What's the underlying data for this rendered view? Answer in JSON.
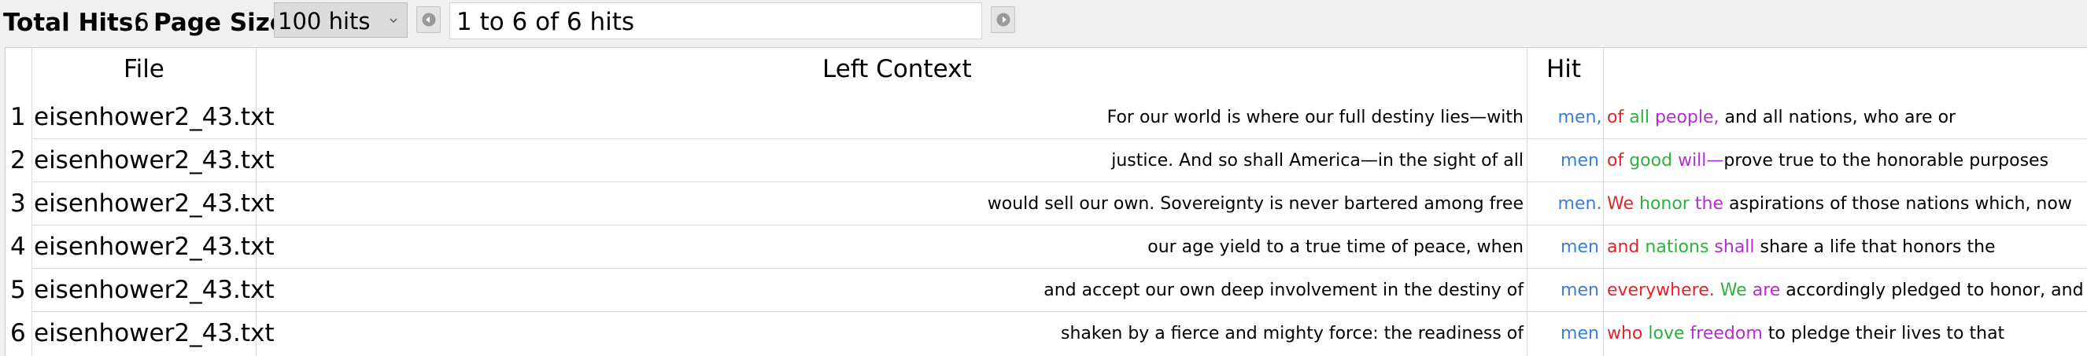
{
  "toolbar": {
    "total_hits_label": "Total Hits:",
    "total_hits_value": "6",
    "page_size_label": "Page Size",
    "page_size_value": "100 hits",
    "range_text": "1 to 6 of 6 hits",
    "prev_icon": "arrow-left-circle-icon",
    "next_icon": "arrow-right-circle-icon"
  },
  "columns": {
    "file": "File",
    "left_context": "Left Context",
    "hit": "Hit",
    "right_context": ""
  },
  "colors": {
    "hit": "#3b7ddd",
    "right_word_1": "#e3232a",
    "right_word_2": "#2db23e",
    "right_word_3": "#b32ed0"
  },
  "rows": [
    {
      "num": "1",
      "file": "eisenhower2_43.txt",
      "left": "For our world is where our full destiny lies—with",
      "hit": "men,",
      "r1": "of",
      "r2": "all",
      "r3": "people,",
      "rest": "and all nations, who are or"
    },
    {
      "num": "2",
      "file": "eisenhower2_43.txt",
      "left": "justice. And so shall America—in the sight of all",
      "hit": "men",
      "r1": "of",
      "r2": "good",
      "r3": "will—",
      "rest": "prove true to the honorable purposes"
    },
    {
      "num": "3",
      "file": "eisenhower2_43.txt",
      "left": "would sell our own. Sovereignty is never bartered among free",
      "hit": "men.",
      "r1": "We",
      "r2": "honor",
      "r3": "the",
      "rest": "aspirations of those nations which, now"
    },
    {
      "num": "4",
      "file": "eisenhower2_43.txt",
      "left": "our age yield to a true time of peace, when",
      "hit": "men",
      "r1": "and",
      "r2": "nations",
      "r3": "shall",
      "rest": "share a life that honors the"
    },
    {
      "num": "5",
      "file": "eisenhower2_43.txt",
      "left": "and accept our own deep involvement in the destiny of",
      "hit": "men",
      "r1": "everywhere.",
      "r2": "We",
      "r3": "are",
      "rest": "accordingly pledged to honor, and to"
    },
    {
      "num": "6",
      "file": "eisenhower2_43.txt",
      "left": "shaken by a fierce and mighty force: the readiness of",
      "hit": "men",
      "r1": "who",
      "r2": "love",
      "r3": "freedom",
      "rest": "to pledge their lives to that"
    }
  ]
}
